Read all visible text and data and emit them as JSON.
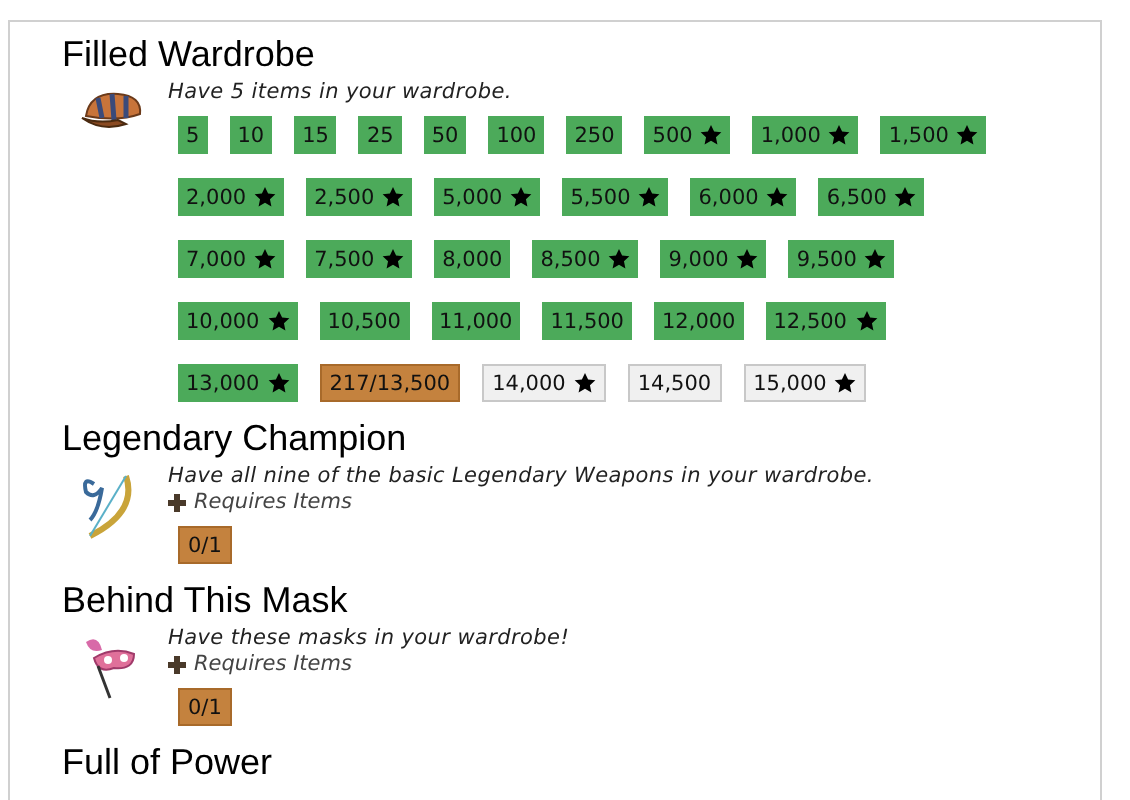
{
  "achievements": [
    {
      "title": "Filled Wardrobe",
      "kind": "hat",
      "description": "Have 5 items in your wardrobe.",
      "tier_rows": [
        [
          {
            "label": "5",
            "kind": "done",
            "star": false
          },
          {
            "label": "10",
            "kind": "done",
            "star": false
          },
          {
            "label": "15",
            "kind": "done",
            "star": false
          },
          {
            "label": "25",
            "kind": "done",
            "star": false
          },
          {
            "label": "50",
            "kind": "done",
            "star": false
          },
          {
            "label": "100",
            "kind": "done",
            "star": false
          },
          {
            "label": "250",
            "kind": "done",
            "star": false
          },
          {
            "label": "500",
            "kind": "done",
            "star": true
          },
          {
            "label": "1,000",
            "kind": "done",
            "star": true
          },
          {
            "label": "1,500",
            "kind": "done",
            "star": true
          }
        ],
        [
          {
            "label": "2,000",
            "kind": "done",
            "star": true
          },
          {
            "label": "2,500",
            "kind": "done",
            "star": true
          },
          {
            "label": "5,000",
            "kind": "done",
            "star": true
          },
          {
            "label": "5,500",
            "kind": "done",
            "star": true
          },
          {
            "label": "6,000",
            "kind": "done",
            "star": true
          },
          {
            "label": "6,500",
            "kind": "done",
            "star": true
          }
        ],
        [
          {
            "label": "7,000",
            "kind": "done",
            "star": true
          },
          {
            "label": "7,500",
            "kind": "done",
            "star": true
          },
          {
            "label": "8,000",
            "kind": "done",
            "star": false
          },
          {
            "label": "8,500",
            "kind": "done",
            "star": true
          },
          {
            "label": "9,000",
            "kind": "done",
            "star": true
          },
          {
            "label": "9,500",
            "kind": "done",
            "star": true
          }
        ],
        [
          {
            "label": "10,000",
            "kind": "done",
            "star": true
          },
          {
            "label": "10,500",
            "kind": "done",
            "star": false
          },
          {
            "label": "11,000",
            "kind": "done",
            "star": false
          },
          {
            "label": "11,500",
            "kind": "done",
            "star": false
          },
          {
            "label": "12,000",
            "kind": "done",
            "star": false
          },
          {
            "label": "12,500",
            "kind": "done",
            "star": true
          }
        ],
        [
          {
            "label": "13,000",
            "kind": "done",
            "star": true
          },
          {
            "label": "217/13,500",
            "kind": "progress",
            "star": false
          },
          {
            "label": "14,000",
            "kind": "locked",
            "star": true
          },
          {
            "label": "14,500",
            "kind": "locked",
            "star": false
          },
          {
            "label": "15,000",
            "kind": "locked",
            "star": true
          }
        ]
      ]
    },
    {
      "title": "Legendary Champion",
      "kind": "bow",
      "description": "Have all nine of the basic Legendary Weapons in your wardrobe.",
      "requires": "Requires Items",
      "tier_rows": [
        [
          {
            "label": "0/1",
            "kind": "progress",
            "star": false
          }
        ]
      ]
    },
    {
      "title": "Behind This Mask",
      "kind": "mask",
      "description": "Have these masks in your wardrobe!",
      "requires": "Requires Items",
      "tier_rows": [
        [
          {
            "label": "0/1",
            "kind": "progress",
            "star": false
          }
        ]
      ]
    },
    {
      "title": "Full of Power"
    }
  ]
}
